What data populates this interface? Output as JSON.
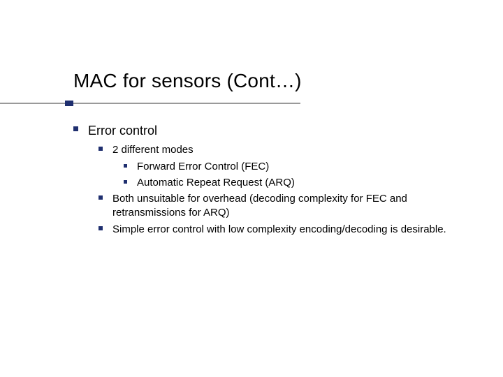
{
  "title": "MAC for sensors (Cont…)",
  "body": {
    "level1": {
      "text": "Error control"
    },
    "level2": [
      {
        "text": "2 different modes"
      },
      {
        "text": "Both unsuitable for overhead (decoding complexity for FEC and retransmissions for ARQ)"
      },
      {
        "text": "Simple error control with low complexity encoding/decoding is desirable."
      }
    ],
    "level3": [
      {
        "text": "Forward Error Control (FEC)"
      },
      {
        "text": "Automatic Repeat Request (ARQ)"
      }
    ]
  }
}
